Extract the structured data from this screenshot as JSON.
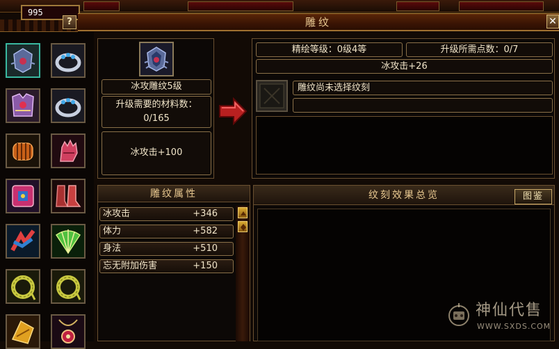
{
  "window": {
    "title": "雕纹",
    "help_label": "?",
    "close_label": "✕",
    "currency_value": "995"
  },
  "equipment_slots": [
    {
      "icon": "carved-gem-icon",
      "selected": true
    },
    {
      "icon": "jade-ring-icon",
      "selected": false
    },
    {
      "icon": "armor-icon",
      "selected": false
    },
    {
      "icon": "jade-ring-icon",
      "selected": false
    },
    {
      "icon": "bracer-icon",
      "selected": false
    },
    {
      "icon": "glove-icon",
      "selected": false
    },
    {
      "icon": "belt-icon",
      "selected": false
    },
    {
      "icon": "boots-icon",
      "selected": false
    },
    {
      "icon": "ribbon-icon",
      "selected": false
    },
    {
      "icon": "fan-weapon-icon",
      "selected": false
    },
    {
      "icon": "jade-bracelet-icon",
      "selected": false
    },
    {
      "icon": "jade-bracelet-icon",
      "selected": false
    },
    {
      "icon": "horn-icon",
      "selected": false
    },
    {
      "icon": "pendant-icon",
      "selected": false
    }
  ],
  "carving": {
    "item_name": "冰攻雕纹5级",
    "material_label": "升级需要的材料数：",
    "material_count": "0/165",
    "current_effect": "冰攻击+100"
  },
  "upgrade": {
    "level_label": "精绘等级：0级4等",
    "points_label": "升级所需点数：0/7",
    "next_effect": "冰攻击+26",
    "select_hint": "雕纹尚未选择纹刻",
    "sub_hint": ""
  },
  "attributes": {
    "header": "雕纹属性",
    "rows": [
      {
        "name": "冰攻击",
        "value": "+346"
      },
      {
        "name": "体力",
        "value": "+582"
      },
      {
        "name": "身法",
        "value": "+510"
      },
      {
        "name": "忘无附加伤害",
        "value": "+150"
      }
    ]
  },
  "overview": {
    "header": "纹刻效果总览",
    "catalog_button": "图鉴"
  },
  "watermark": {
    "text_cn": "神仙代售",
    "url": "WWW.SXDS.COM"
  },
  "colors": {
    "selected_slot": "#3ab8a0",
    "gold_border": "#a07030",
    "arrow_red": "#b82020"
  }
}
